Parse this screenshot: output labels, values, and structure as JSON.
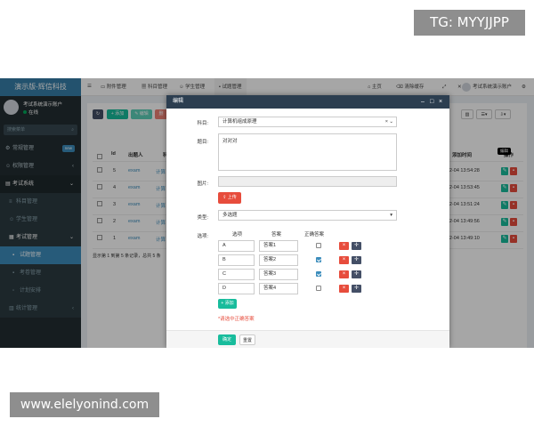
{
  "watermarks": {
    "top": "TG: MYYJJPP",
    "bottom": "www.elelyonind.com"
  },
  "sidebar": {
    "brand": "演示版-辉信科技",
    "user_name": "考试系统演示账户",
    "user_status": "在线",
    "search_placeholder": "搜索菜单",
    "items": [
      {
        "label": "常规管理",
        "badge": "new",
        "icon": "gear-icon"
      },
      {
        "label": "权限管理",
        "arrow": "‹",
        "icon": "users-icon"
      },
      {
        "label": "考试系统",
        "arrow": "⌄",
        "icon": "book-icon"
      },
      {
        "label": "科目管理",
        "icon": "list-icon"
      },
      {
        "label": "学生管理",
        "icon": "user-icon"
      },
      {
        "label": "考试管理",
        "arrow": "⌄",
        "icon": "file-icon"
      },
      {
        "label": "试题管理",
        "icon": "file-text-icon"
      },
      {
        "label": "考卷管理",
        "icon": "paper-icon"
      },
      {
        "label": "计划安排",
        "icon": "calendar-icon"
      },
      {
        "label": "统计管理",
        "arrow": "‹",
        "icon": "chart-icon"
      }
    ]
  },
  "topbar": {
    "tabs": [
      "附件管理",
      "科目管理",
      "学生管理",
      "试题管理"
    ],
    "home": "主页",
    "clear_cache": "清除缓存",
    "account": "考试系统演示账户"
  },
  "toolbar": {
    "add": "+ 添加",
    "edit": "✎ 编辑",
    "delete": "删"
  },
  "table": {
    "headers": [
      "Id",
      "出题人",
      "科",
      "添加时间",
      "操作"
    ],
    "rows": [
      {
        "id": "5",
        "author": "exam",
        "subject": "计算",
        "time": "-02-04 13:54:28"
      },
      {
        "id": "4",
        "author": "exam",
        "subject": "计算",
        "time": "-02-04 13:53:45"
      },
      {
        "id": "3",
        "author": "exam",
        "subject": "计算",
        "time": "-02-04 13:51:24"
      },
      {
        "id": "2",
        "author": "exam",
        "subject": "计算",
        "time": "-02-04 13:49:56"
      },
      {
        "id": "1",
        "author": "exam",
        "subject": "计算",
        "time": "-02-04 13:49:10"
      }
    ],
    "footer": "显示第 1 到第 5 条记录，总共 5 条",
    "tooltip": "编辑"
  },
  "modal": {
    "title": "编辑",
    "controls": [
      "–",
      "□",
      "×"
    ],
    "subject_label": "科目:",
    "subject_value": "计算机组成原理",
    "stem_label": "题目:",
    "stem_value": "对对对",
    "image_label": "图片:",
    "upload_label": "上传",
    "type_label": "类型:",
    "type_value": "多选题",
    "options_label": "选项:",
    "option_headers": [
      "选项",
      "答案",
      "正确答案"
    ],
    "options": [
      {
        "key": "A",
        "answer": "答案1",
        "correct": false
      },
      {
        "key": "B",
        "answer": "答案2",
        "correct": true
      },
      {
        "key": "C",
        "answer": "答案3",
        "correct": true
      },
      {
        "key": "D",
        "answer": "答案4",
        "correct": false
      }
    ],
    "add_option": "+ 添加",
    "warning": "*请选中正确答案",
    "confirm": "确定",
    "reset": "重置"
  }
}
